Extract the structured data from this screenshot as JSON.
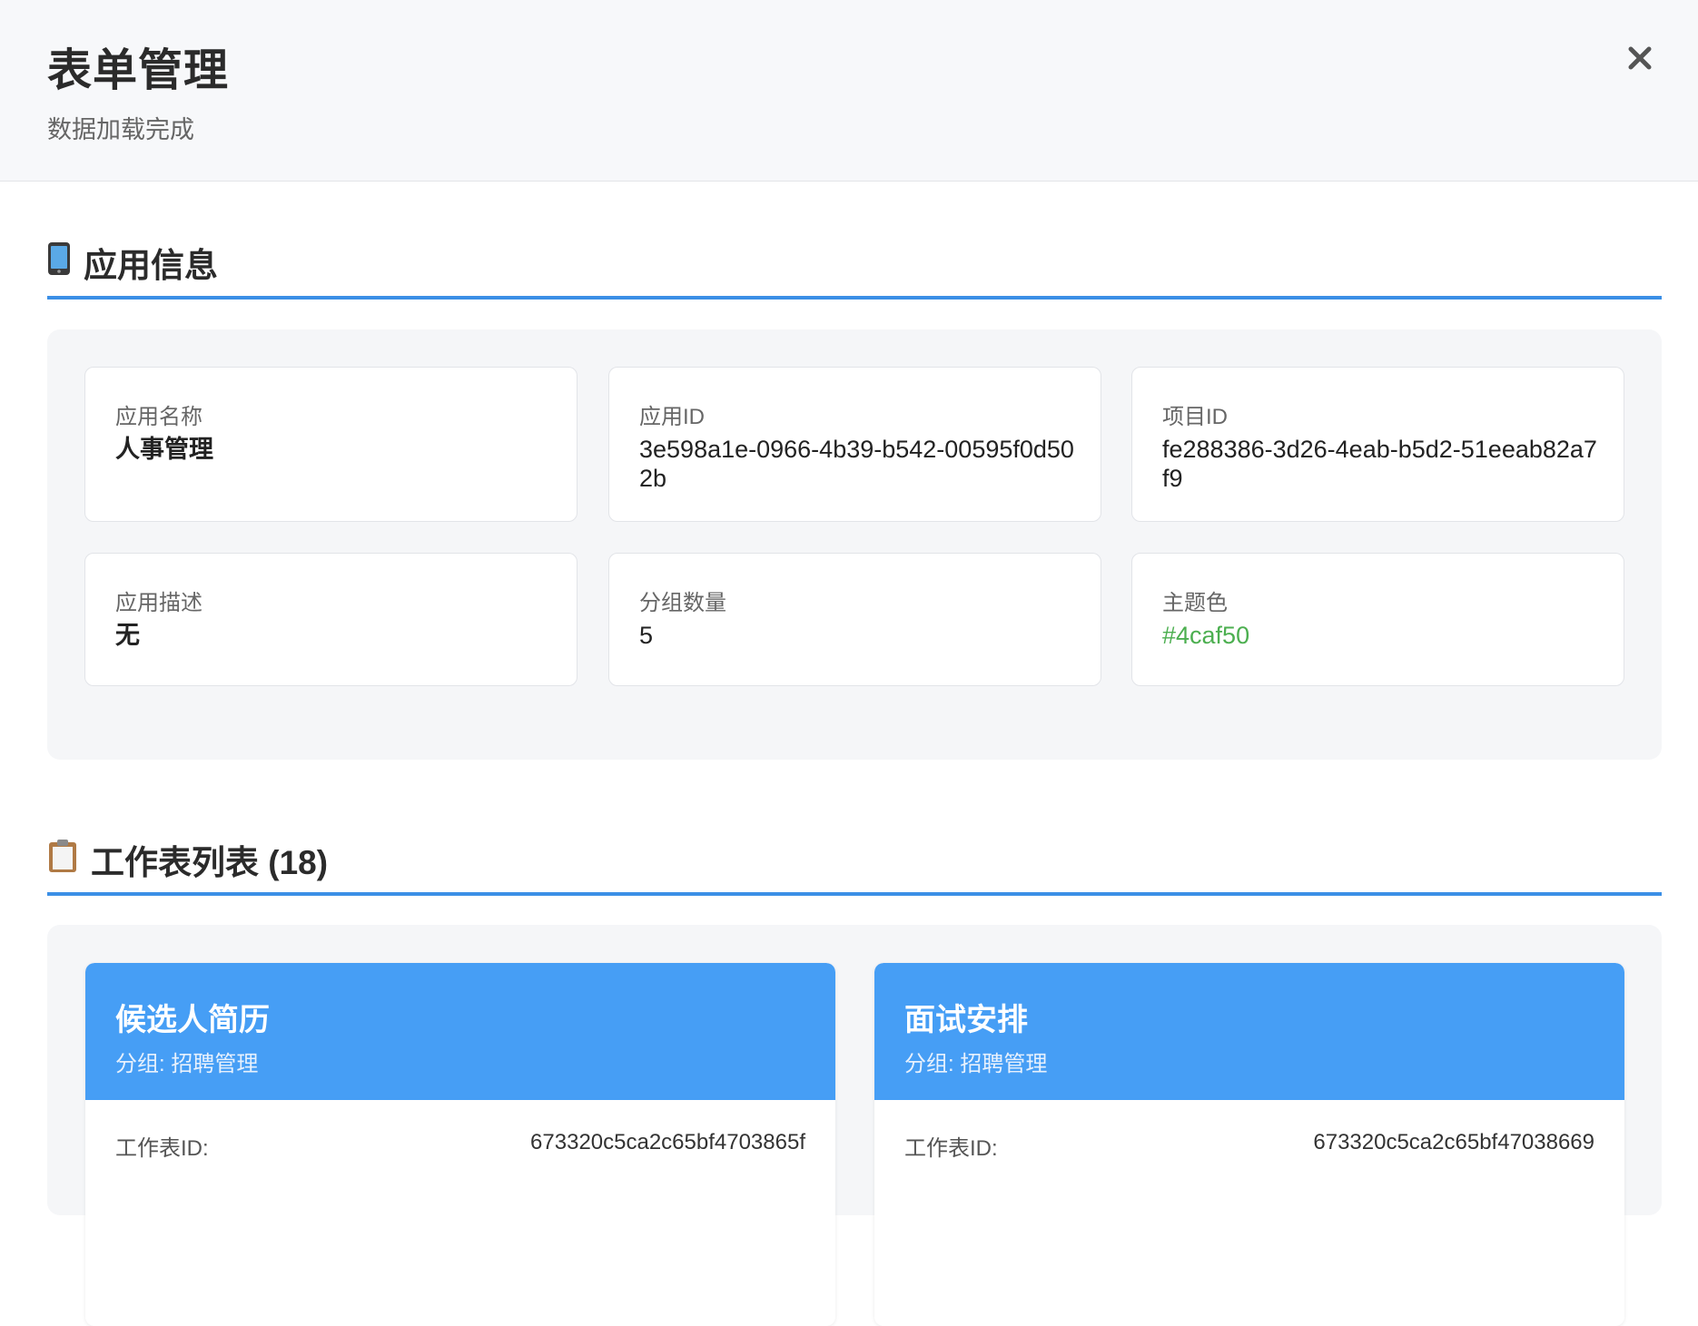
{
  "header": {
    "title": "表单管理",
    "subtitle": "数据加载完成",
    "close_icon": "close-icon"
  },
  "app_section": {
    "icon": "mobile-phone-icon",
    "title": "应用信息",
    "cards": [
      {
        "label": "应用名称",
        "value": "人事管理"
      },
      {
        "label": "应用ID",
        "value": "3e598a1e-0966-4b39-b542-00595f0d502b"
      },
      {
        "label": "项目ID",
        "value": "fe288386-3d26-4eab-b5d2-51eeab82a7f9"
      },
      {
        "label": "应用描述",
        "value": "无"
      },
      {
        "label": "分组数量",
        "value": "5"
      },
      {
        "label": "主题色",
        "value": "#4caf50"
      }
    ],
    "theme_color": "#4caf50"
  },
  "worksheet_section": {
    "icon": "clipboard-icon",
    "title": "工作表列表 (18)",
    "worksheets": [
      {
        "name": "候选人简历",
        "group": "分组: 招聘管理",
        "id_label": "工作表ID:",
        "id_value": "673320c5ca2c65bf4703865f"
      },
      {
        "name": "面试安排",
        "group": "分组: 招聘管理",
        "id_label": "工作表ID:",
        "id_value": "673320c5ca2c65bf47038669"
      }
    ]
  },
  "colors": {
    "accent": "#3b8fe6",
    "card_header": "#469ef5",
    "theme_green": "#4caf50"
  }
}
